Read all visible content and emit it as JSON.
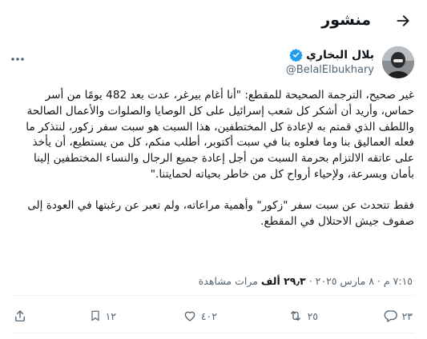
{
  "header": {
    "title": "منشور",
    "back_icon": "arrow-back-icon"
  },
  "author": {
    "display_name": "بلال البخاري",
    "handle": "@BelalElbukhary",
    "verified_icon": "verified-badge-icon",
    "badge_color": "#1d9bf0"
  },
  "tweet": {
    "paragraph_1": "غير صحيح، الترجمة الصحيحة للمقطع: \"أنا أغام بيرغر، عدت بعد 482 يومًا من أسر حماس، وأريد أن أشكر كل شعب إسرائيل على كل الوصايا والصلوات والأعمال الصالحة واللطف الذي قمتم به لإعادة كل المختطفين، هذا السبت هو سبت سفر زكور، لنتذكر ما فعله العماليق بنا وما فعلوه بنا في سبت أكتوبر، أطلب منكم، كل من يستطيع، أن يأخذ على عاتقه الالتزام بحرمة السبت من أجل إعادة جميع الرجال والنساء المختطفين إلينا بأمان وبسرعة، ولإحياء أرواح كل من خاطر بحياته لحمايتنا.\"",
    "paragraph_2": "فقط تتحدث عن سبت سفر \"زكور\" وأهمية مراعاته، ولم تعبر عن رغبتها في العودة إلى صفوف جيش الاحتلال في المقطع."
  },
  "meta": {
    "time": "٧:١٥ م",
    "date": "٨ مارس ٢٠٢٥",
    "views_count": "٢٩٫٣ ألف",
    "views_label": "مرات مشاهدة",
    "separator": "·"
  },
  "actions": {
    "replies": "٢٣",
    "retweets": "٢٥",
    "likes": "٤٠٢",
    "bookmarks": "١٢"
  }
}
